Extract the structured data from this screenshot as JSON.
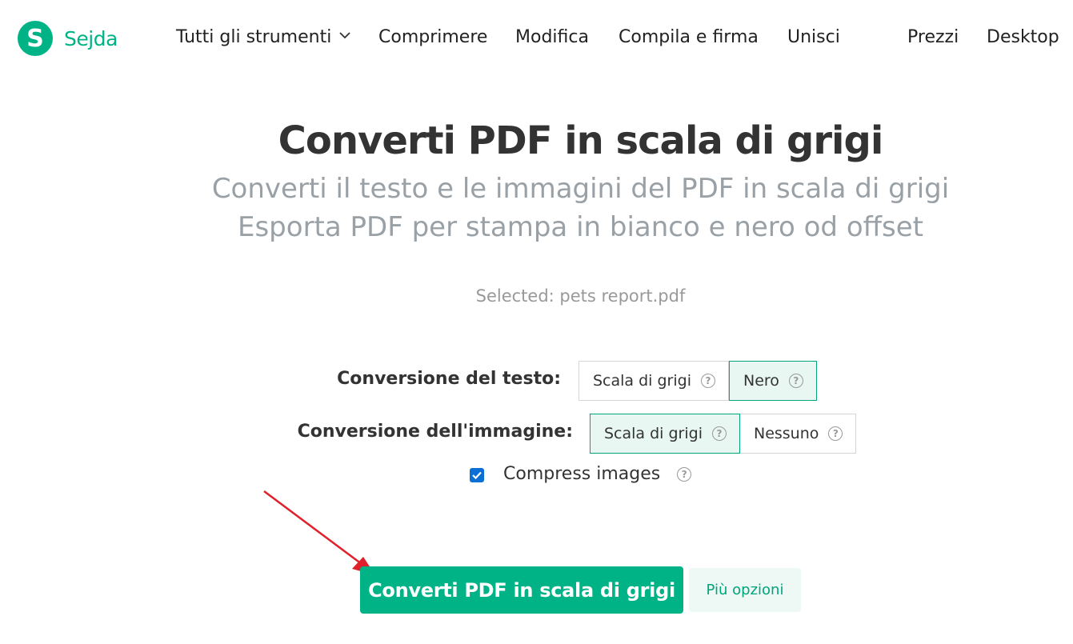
{
  "header": {
    "logo_letter": "S",
    "logo_text": "Sejda",
    "nav": {
      "all_tools": "Tutti gli strumenti",
      "compress": "Comprimere",
      "edit": "Modifica",
      "fill_sign": "Compila e firma",
      "merge": "Unisci",
      "pricing": "Prezzi",
      "desktop": "Desktop"
    }
  },
  "hero": {
    "title": "Converti PDF in scala di grigi",
    "subtitle_line1": "Converti il testo e le immagini del PDF in scala di grigi",
    "subtitle_line2": "Esporta PDF per stampa in bianco e nero od offset"
  },
  "selected_file": "Selected: pets report.pdf",
  "options": {
    "text_conversion": {
      "label": "Conversione del testo:",
      "choices": [
        "Scala di grigi",
        "Nero"
      ],
      "selected": "Nero"
    },
    "image_conversion": {
      "label": "Conversione dell'immagine:",
      "choices": [
        "Scala di grigi",
        "Nessuno"
      ],
      "selected": "Scala di grigi"
    },
    "compress_images": {
      "label": "Compress images",
      "checked": true
    },
    "help_glyph": "?"
  },
  "actions": {
    "primary_label": "Converti PDF in scala di grigi",
    "more_options_label": "Più opzioni"
  },
  "colors": {
    "brand": "#00b386",
    "annotation_arrow": "#e0202a",
    "checkbox": "#0b6fd6"
  }
}
